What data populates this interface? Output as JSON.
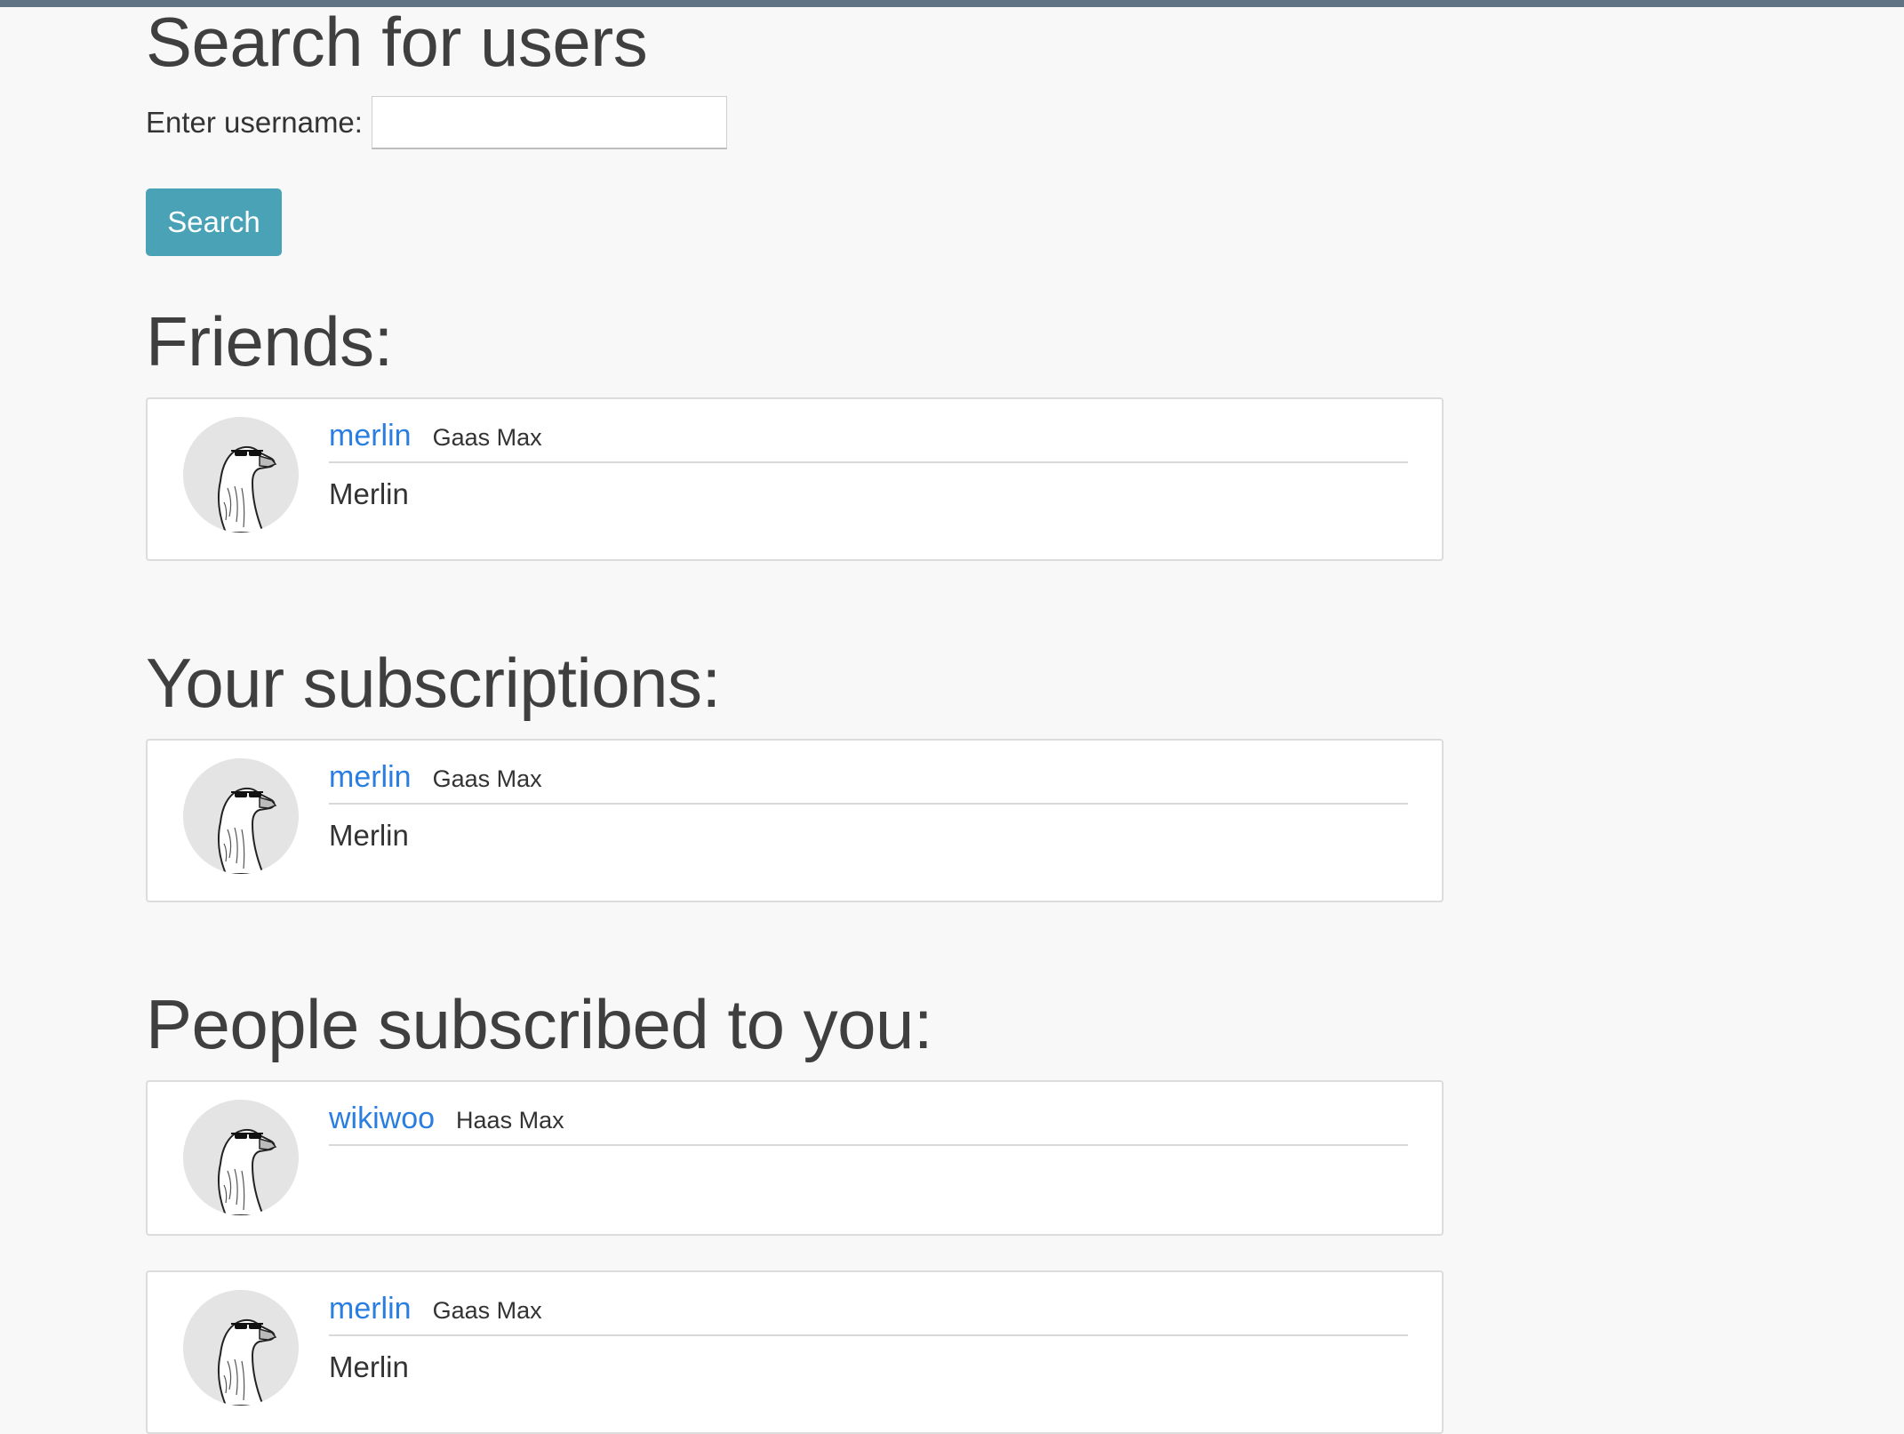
{
  "page": {
    "title": "Search for users"
  },
  "search": {
    "label": "Enter username:",
    "value": "",
    "placeholder": "",
    "button_label": "Search"
  },
  "sections": {
    "friends": {
      "heading": "Friends:",
      "users": [
        {
          "username": "merlin",
          "full_name": "Gaas Max",
          "display_name": "Merlin",
          "avatar": "goose-with-sunglasses-icon"
        }
      ]
    },
    "subscriptions": {
      "heading": "Your subscriptions:",
      "users": [
        {
          "username": "merlin",
          "full_name": "Gaas Max",
          "display_name": "Merlin",
          "avatar": "goose-with-sunglasses-icon"
        }
      ]
    },
    "subscribers": {
      "heading": "People subscribed to you:",
      "users": [
        {
          "username": "wikiwoo",
          "full_name": "Haas Max",
          "display_name": "",
          "avatar": "goose-with-sunglasses-icon"
        },
        {
          "username": "merlin",
          "full_name": "Gaas Max",
          "display_name": "Merlin",
          "avatar": "goose-with-sunglasses-icon"
        }
      ]
    }
  },
  "colors": {
    "top_bar": "#5f7385",
    "search_button": "#4aa2b7",
    "link": "#2a7ee0",
    "background": "#f8f8f8"
  }
}
